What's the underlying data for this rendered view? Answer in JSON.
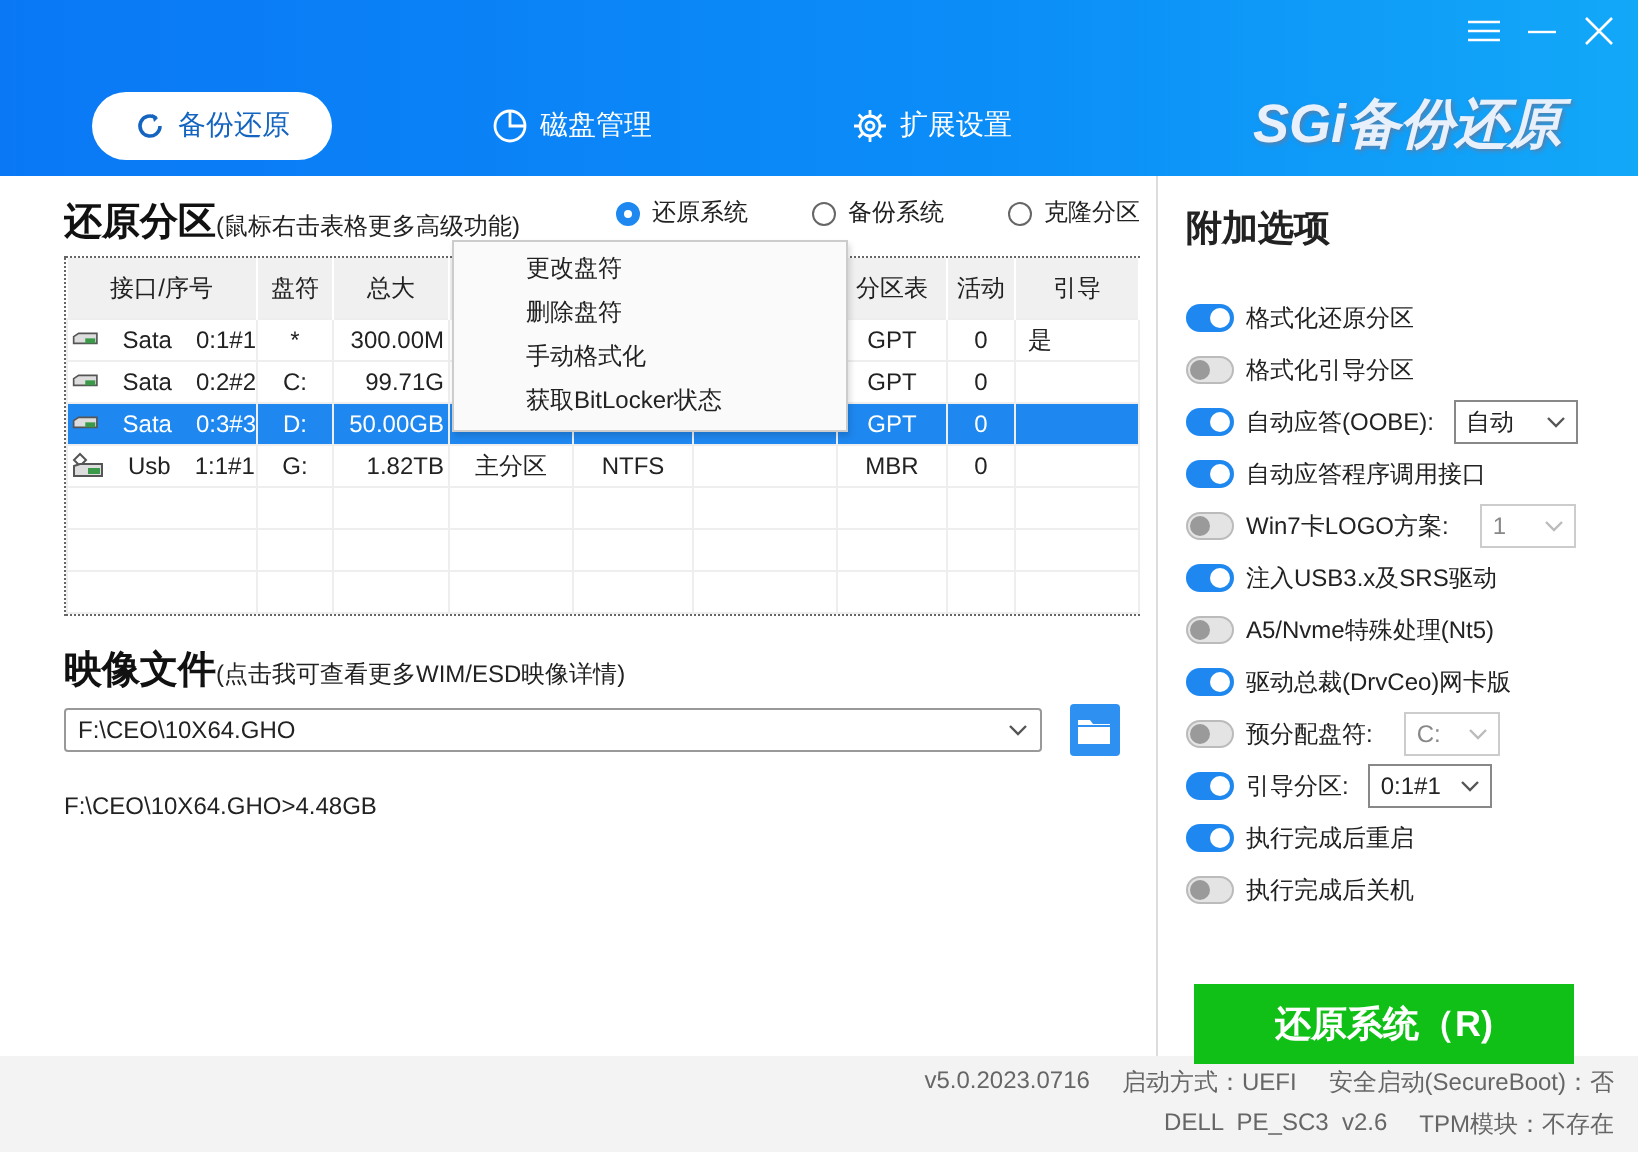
{
  "window": {
    "logo": "SGi备份还原"
  },
  "tabs": [
    {
      "label": "备份还原",
      "selected": true
    },
    {
      "label": "磁盘管理",
      "selected": false
    },
    {
      "label": "扩展设置",
      "selected": false
    }
  ],
  "partitions": {
    "title": "还原分区",
    "hint": "(鼠标右击表格更多高级功能)",
    "modes": [
      {
        "label": "还原系统",
        "selected": true
      },
      {
        "label": "备份系统",
        "selected": false
      },
      {
        "label": "克隆分区",
        "selected": false
      }
    ],
    "columns": [
      "接口/序号",
      "盘符",
      "总大",
      "",
      "",
      "",
      "分区表",
      "活动",
      "引导"
    ],
    "rows": [
      {
        "kind": "disk",
        "interface": "Sata",
        "index": "0:1#1",
        "letter": "*",
        "size": "300.00M",
        "partition_table": "GPT",
        "active": "0",
        "boot": "是",
        "selected": false
      },
      {
        "kind": "disk",
        "interface": "Sata",
        "index": "0:2#2",
        "letter": "C:",
        "size": "99.71G",
        "partition_table": "GPT",
        "active": "0",
        "selected": false
      },
      {
        "kind": "disk",
        "interface": "Sata",
        "index": "0:3#3",
        "letter": "D:",
        "size": "50.00GB",
        "partition_table": "GPT",
        "active": "0",
        "selected": true
      },
      {
        "kind": "usb",
        "interface": "Usb",
        "index": "1:1#1",
        "letter": "G:",
        "size": "1.82TB",
        "type": "主分区",
        "filesystem": "NTFS",
        "partition_table": "MBR",
        "active": "0",
        "selected": false
      }
    ],
    "context_menu": [
      "更改盘符",
      "删除盘符",
      "手动格式化",
      "获取BitLocker状态"
    ]
  },
  "image": {
    "title": "映像文件",
    "hint": "(点击我可查看更多WIM/ESD映像详情)",
    "value": "F:\\CEO\\10X64.GHO",
    "info": "F:\\CEO\\10X64.GHO>4.48GB"
  },
  "options": {
    "title": "附加选项",
    "items": [
      {
        "label": "格式化还原分区",
        "on": true
      },
      {
        "label": "格式化引导分区",
        "on": false
      },
      {
        "label": "自动应答(OOBE):",
        "on": true,
        "select": {
          "value": "自动",
          "disabled": false
        }
      },
      {
        "label": "自动应答程序调用接口",
        "on": true
      },
      {
        "label": "Win7卡LOGO方案:",
        "on": false,
        "select": {
          "value": "1",
          "disabled": true
        }
      },
      {
        "label": "注入USB3.x及SRS驱动",
        "on": true
      },
      {
        "label": "A5/Nvme特殊处理(Nt5)",
        "on": false
      },
      {
        "label": "驱动总裁(DrvCeo)网卡版",
        "on": true
      },
      {
        "label": "预分配盘符:",
        "on": false,
        "select": {
          "value": "C:",
          "disabled": true
        }
      },
      {
        "label": "引导分区:",
        "on": true,
        "select": {
          "value": "0:1#1",
          "disabled": false
        }
      },
      {
        "label": "执行完成后重启",
        "on": true
      },
      {
        "label": "执行完成后关机",
        "on": false
      }
    ],
    "action": "还原系统（R)"
  },
  "status": {
    "line_1": [
      "v5.0.2023.0716",
      "启动方式：UEFI",
      "安全启动(SecureBoot)：否"
    ],
    "line_2": [
      "DELL  PE_SC3  v2.6",
      "TPM模块：不存在"
    ]
  }
}
